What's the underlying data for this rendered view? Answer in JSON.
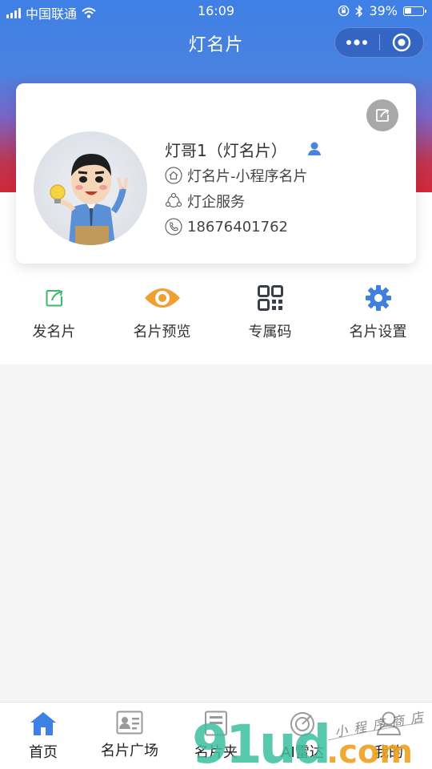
{
  "status_bar": {
    "carrier": "中国联通",
    "time": "16:09",
    "battery": "39%",
    "battery_level": 0.39
  },
  "nav": {
    "title": "灯名片"
  },
  "card": {
    "name": "灯哥1（灯名片）",
    "company": "灯名片-小程序名片",
    "department": "灯企服务",
    "phone": "18676401762"
  },
  "actions": [
    {
      "label": "发名片",
      "icon": "share-icon"
    },
    {
      "label": "名片预览",
      "icon": "eye-icon"
    },
    {
      "label": "专属码",
      "icon": "qrcode-icon"
    },
    {
      "label": "名片设置",
      "icon": "gear-icon"
    }
  ],
  "tabs": [
    {
      "label": "首页",
      "icon": "home-icon",
      "active": true
    },
    {
      "label": "名片广场",
      "icon": "card-icon"
    },
    {
      "label": "名片夹",
      "icon": "folder-icon"
    },
    {
      "label": "AI雷达",
      "icon": "radar-icon"
    },
    {
      "label": "我的",
      "icon": "user-icon"
    }
  ],
  "watermark": {
    "logo": "91ud.com",
    "tagline": "小程序商店"
  },
  "colors": {
    "primary": "#3f80e6",
    "accent_red": "#d0283a",
    "eye_orange": "#f0a030",
    "share_green": "#3cb868"
  }
}
